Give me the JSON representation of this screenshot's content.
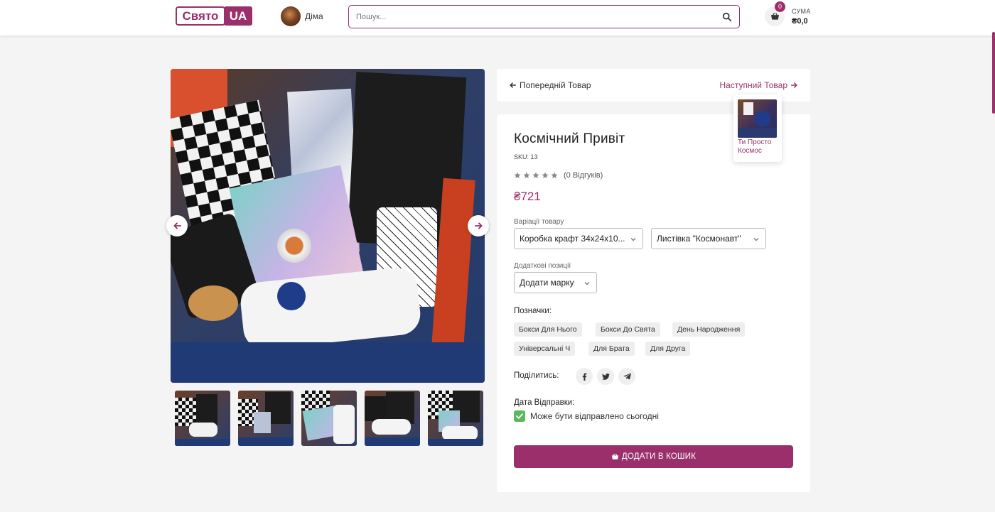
{
  "header": {
    "logo_word1": "Свято",
    "logo_word2": "UA",
    "user_name": "Діма",
    "search_placeholder": "Пошук...",
    "cart_count": "0",
    "sum_label": "СУМА",
    "sum_value": "₴0,0"
  },
  "navigation": {
    "prev_label": "Попередній Товар",
    "next_label": "Наступний Товар",
    "next_product_title": "Ти Просто Космос"
  },
  "product": {
    "title": "Космічний Привіт",
    "sku": "SKU: 13",
    "rating": 0,
    "reviews": "(0 Відгуків)",
    "price": "₴721",
    "variations_label": "Варіації товару",
    "variation_1": "Коробка крафт 34х24х10...",
    "variation_2": "Листівка \"Космонавт\"",
    "additional_label": "Додаткові позиції",
    "additional_select": "Додати марку",
    "tags_label": "Позначки:",
    "tags": [
      "Бокси Для Нього",
      "Бокси До Свята",
      "День Народження",
      "Універсальні Ч",
      "Для Брата",
      "Для Друга"
    ],
    "share_label": "Поділитись:",
    "ship_label": "Дата Відправки:",
    "ship_text": "Може бути відправлено сьогодні",
    "add_to_cart": "ДОДАТИ В КОШИК"
  },
  "gallery": {
    "thumbnail_count": 5
  },
  "colors": {
    "brand": "#9b2f6b",
    "check": "#5cb85c",
    "background": "#f4f4f4"
  },
  "icons": [
    "search-icon",
    "basket-icon",
    "arrow-left-icon",
    "arrow-right-icon",
    "star-icon",
    "chevron-down-icon",
    "facebook-icon",
    "twitter-icon",
    "telegram-icon",
    "check-icon"
  ]
}
